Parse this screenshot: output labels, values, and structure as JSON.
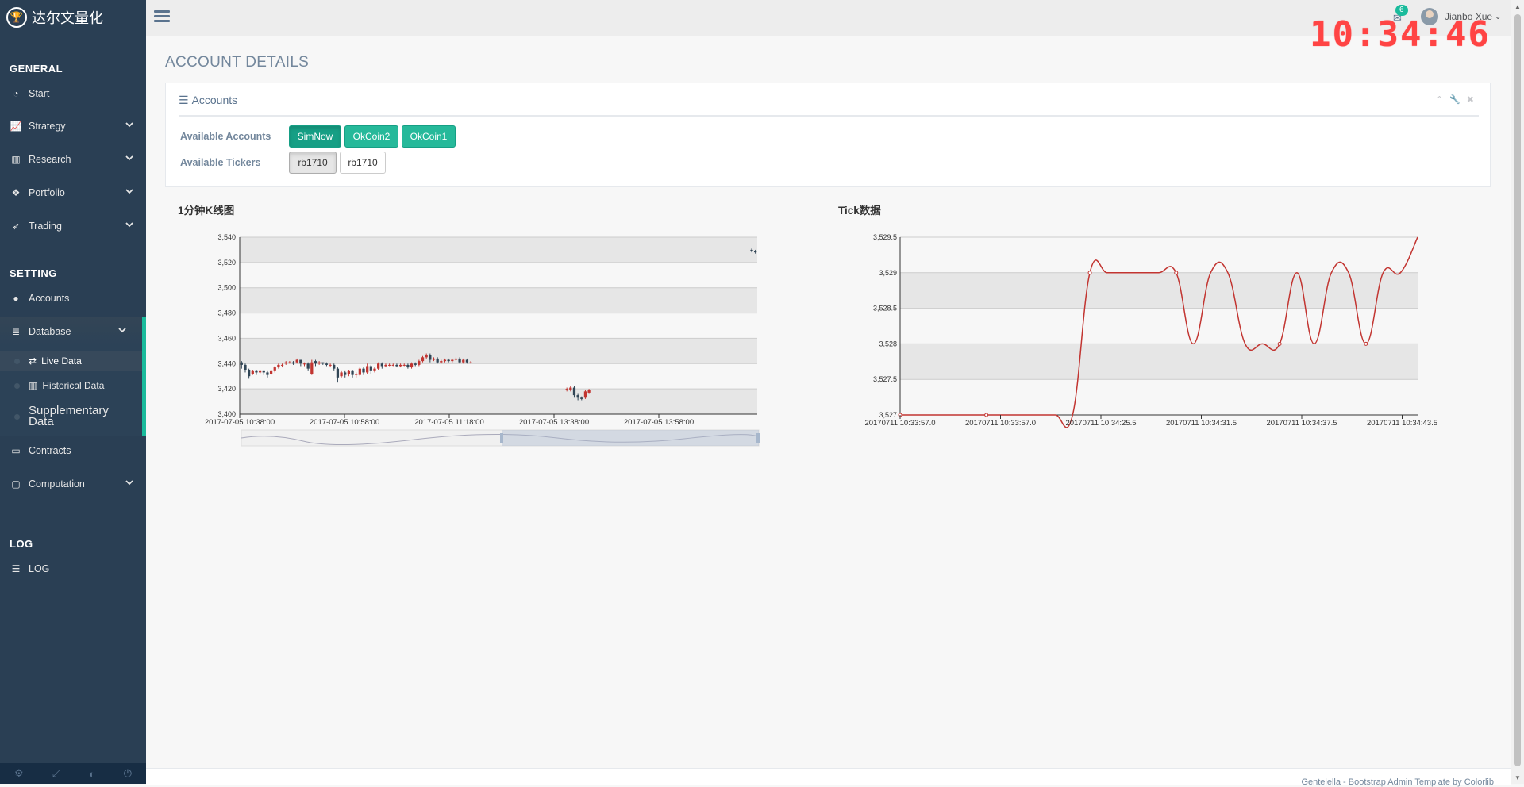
{
  "brand": {
    "name": "达尔文量化",
    "logo_icon": "trophy-icon"
  },
  "sidebar": {
    "sections": {
      "general": "GENERAL",
      "setting": "SETTING",
      "log": "LOG"
    },
    "general_items": [
      {
        "label": "Start",
        "icon": "dashboard-icon"
      },
      {
        "label": "Strategy",
        "icon": "line-chart-icon"
      },
      {
        "label": "Research",
        "icon": "bar-chart-icon"
      },
      {
        "label": "Portfolio",
        "icon": "cubes-icon"
      },
      {
        "label": "Trading",
        "icon": "rocket-icon"
      }
    ],
    "setting_items": {
      "accounts": "Accounts",
      "database": "Database",
      "contracts": "Contracts",
      "computation": "Computation"
    },
    "database_sub": [
      "Live Data",
      "Historical Data",
      "Supplementary Data"
    ],
    "log_item": "LOG"
  },
  "topbar": {
    "clock": "10:34:46",
    "notification_count": "6",
    "user_name": "Jianbo Xue"
  },
  "page": {
    "title": "ACCOUNT DETAILS"
  },
  "accounts_panel": {
    "title": "Accounts",
    "available_accounts_label": "Available Accounts",
    "available_tickers_label": "Available Tickers",
    "accounts": [
      "SimNow",
      "OkCoin2",
      "OkCoin1"
    ],
    "tickers": [
      "rb1710",
      "rb1710"
    ]
  },
  "footer": {
    "text": "Gentelella - Bootstrap Admin Template by Colorlib"
  },
  "chart_data": [
    {
      "type": "candlestick",
      "title": "1分钟K线图",
      "ylim": [
        3400,
        3540
      ],
      "yticks": [
        "3,400",
        "3,420",
        "3,440",
        "3,460",
        "3,480",
        "3,500",
        "3,520",
        "3,540"
      ],
      "xticks": [
        "2017-07-05 10:38:00",
        "2017-07-05 10:58:00",
        "2017-07-05 11:18:00",
        "2017-07-05 13:38:00",
        "2017-07-05 13:58:00"
      ],
      "colors": {
        "up": "#c23531",
        "down": "#314656"
      },
      "candles": [
        [
          3441,
          3439,
          3436,
          3442
        ],
        [
          3439,
          3435,
          3433,
          3440
        ],
        [
          3435,
          3430,
          3428,
          3436
        ],
        [
          3432,
          3434,
          3431,
          3435
        ],
        [
          3434,
          3433,
          3431,
          3435
        ],
        [
          3433,
          3434,
          3432,
          3435
        ],
        [
          3434,
          3433,
          3431,
          3434
        ],
        [
          3433,
          3431,
          3429,
          3434
        ],
        [
          3432,
          3434,
          3431,
          3435
        ],
        [
          3434,
          3437,
          3433,
          3438
        ],
        [
          3437,
          3439,
          3436,
          3440
        ],
        [
          3439,
          3439,
          3437,
          3440
        ],
        [
          3440,
          3441,
          3439,
          3442
        ],
        [
          3441,
          3441,
          3440,
          3442
        ],
        [
          3441,
          3440,
          3439,
          3442
        ],
        [
          3441,
          3443,
          3440,
          3444
        ],
        [
          3443,
          3440,
          3438,
          3443
        ],
        [
          3440,
          3440,
          3438,
          3441
        ],
        [
          3440,
          3436,
          3434,
          3441
        ],
        [
          3432,
          3441,
          3431,
          3443
        ],
        [
          3442,
          3440,
          3438,
          3443
        ],
        [
          3440,
          3441,
          3439,
          3442
        ],
        [
          3441,
          3440,
          3439,
          3441
        ],
        [
          3440,
          3439,
          3438,
          3441
        ],
        [
          3439,
          3439,
          3437,
          3440
        ],
        [
          3439,
          3436,
          3434,
          3440
        ],
        [
          3436,
          3429,
          3425,
          3437
        ],
        [
          3430,
          3433,
          3429,
          3434
        ],
        [
          3433,
          3431,
          3429,
          3434
        ],
        [
          3432,
          3434,
          3430,
          3435
        ],
        [
          3434,
          3431,
          3429,
          3435
        ],
        [
          3431,
          3432,
          3429,
          3433
        ],
        [
          3431,
          3436,
          3430,
          3437
        ],
        [
          3436,
          3433,
          3431,
          3437
        ],
        [
          3433,
          3438,
          3432,
          3440
        ],
        [
          3438,
          3434,
          3432,
          3439
        ],
        [
          3434,
          3436,
          3433,
          3437
        ],
        [
          3436,
          3440,
          3435,
          3441
        ],
        [
          3440,
          3438,
          3436,
          3441
        ],
        [
          3438,
          3439,
          3437,
          3440
        ],
        [
          3439,
          3439,
          3438,
          3440
        ],
        [
          3439,
          3439,
          3438,
          3440
        ],
        [
          3439,
          3438,
          3437,
          3440
        ],
        [
          3438,
          3439,
          3437,
          3440
        ],
        [
          3439,
          3439,
          3438,
          3440
        ],
        [
          3439,
          3437,
          3436,
          3440
        ],
        [
          3437,
          3440,
          3436,
          3441
        ],
        [
          3440,
          3439,
          3438,
          3441
        ],
        [
          3439,
          3442,
          3438,
          3443
        ],
        [
          3442,
          3445,
          3441,
          3446
        ],
        [
          3445,
          3447,
          3444,
          3448
        ],
        [
          3447,
          3443,
          3441,
          3448
        ],
        [
          3443,
          3444,
          3442,
          3445
        ],
        [
          3444,
          3441,
          3440,
          3445
        ],
        [
          3441,
          3442,
          3440,
          3443
        ],
        [
          3442,
          3443,
          3441,
          3444
        ],
        [
          3443,
          3442,
          3441,
          3444
        ],
        [
          3442,
          3443,
          3441,
          3444
        ],
        [
          3443,
          3444,
          3442,
          3445
        ],
        [
          3444,
          3441,
          3440,
          3445
        ],
        [
          3441,
          3443,
          3440,
          3444
        ],
        [
          3443,
          3441,
          3440,
          3444
        ],
        [
          3441,
          3441,
          3440,
          3442
        ],
        null,
        null,
        null,
        null,
        null,
        null,
        null,
        null,
        null,
        null,
        null,
        null,
        null,
        null,
        null,
        null,
        null,
        null,
        null,
        null,
        null,
        null,
        null,
        null,
        null,
        [
          3419,
          3420,
          3418,
          3421
        ],
        [
          3419,
          3421,
          3418,
          3422
        ],
        [
          3421,
          3415,
          3413,
          3422
        ],
        [
          3415,
          3413,
          3411,
          3416
        ],
        [
          3413,
          3412,
          3411,
          3414
        ],
        [
          3413,
          3418,
          3412,
          3419
        ],
        [
          3417,
          3419,
          3416,
          3420
        ],
        null,
        null,
        null,
        null,
        null,
        null,
        null,
        null,
        null,
        null,
        null,
        null,
        null,
        null,
        null,
        null,
        null,
        null,
        null,
        null,
        null,
        null,
        null,
        null,
        null,
        null,
        null,
        null,
        null,
        null,
        null,
        null,
        null,
        null,
        null,
        null,
        null,
        null,
        null,
        null,
        null,
        null,
        null,
        [
          3530,
          3529,
          3528,
          3531
        ],
        [
          3529,
          3528,
          3527,
          3530
        ]
      ]
    },
    {
      "type": "line",
      "title": "Tick数据",
      "ylim": [
        3527,
        3529.5
      ],
      "yticks": [
        "3,527",
        "3,527.5",
        "3,528",
        "3,528.5",
        "3,529",
        "3,529.5"
      ],
      "xticks": [
        "20170711 10:33:57.0",
        "20170711 10:33:57.0",
        "20170711 10:34:25.5",
        "20170711 10:34:31.5",
        "20170711 10:34:37.5",
        "20170711 10:34:43.5"
      ],
      "color": "#c23531",
      "x_index": [
        0,
        1,
        2,
        3,
        4,
        5,
        6,
        7,
        8,
        9,
        10,
        11,
        12,
        13,
        14,
        15,
        16,
        17,
        18,
        19,
        20,
        21,
        22,
        23,
        24,
        25,
        26,
        27,
        28,
        29,
        30
      ],
      "values": [
        3527,
        3527,
        3527,
        3527,
        3527,
        3527,
        3527,
        3527,
        3527,
        3527,
        3527,
        3529,
        3529,
        3529,
        3529,
        3529,
        3529,
        3528,
        3529,
        3529,
        3528,
        3528,
        3528,
        3529,
        3528,
        3529,
        3529,
        3528,
        3529,
        3529,
        3529.5
      ]
    }
  ]
}
